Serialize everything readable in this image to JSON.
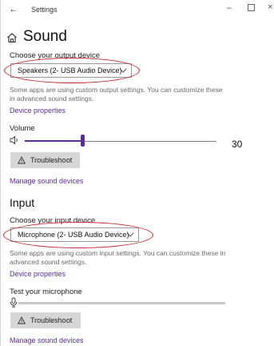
{
  "window": {
    "title": "Settings",
    "back_glyph": "←",
    "minimize_glyph": "–",
    "close_glyph": "×"
  },
  "header": {
    "title": "Sound",
    "icon": "home-icon"
  },
  "output": {
    "label": "Choose your output device",
    "selected": "Speakers (2- USB Audio Device)",
    "description": "Some apps are using custom output settings. You can customize these in advanced sound settings.",
    "properties_link": "Device properties",
    "volume_label": "Volume",
    "volume_value": "30",
    "volume_level": 0.3,
    "troubleshoot_label": "Troubleshoot",
    "manage_link": "Manage sound devices"
  },
  "input": {
    "section_title": "Input",
    "label": "Choose your input device",
    "selected": "Microphone (2- USB Audio Device)",
    "description": "Some apps are using custom input settings. You can customize these in advanced sound settings.",
    "properties_link": "Device properties",
    "test_label": "Test your microphone",
    "mic_level": 0,
    "troubleshoot_label": "Troubleshoot",
    "manage_link": "Manage sound devices"
  },
  "colors": {
    "accent": "#5b2d9a",
    "highlight": "#c0282d",
    "button_bg": "#d6d6d6"
  }
}
